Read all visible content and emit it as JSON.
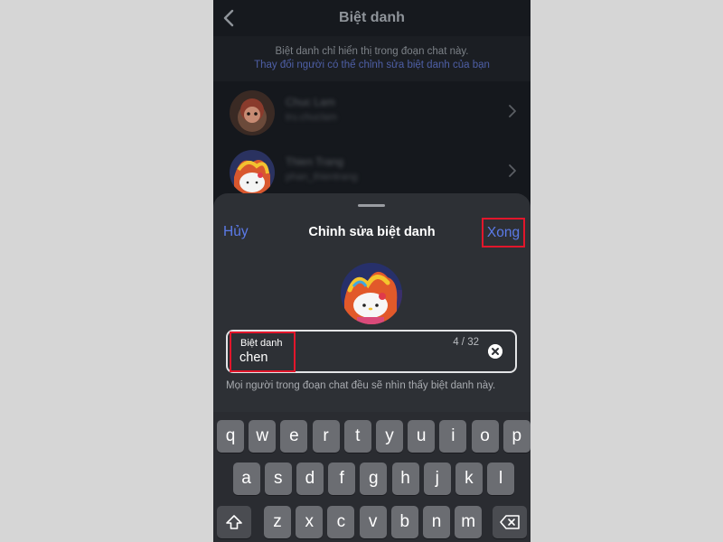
{
  "background_screen": {
    "title": "Biệt danh",
    "info_line1": "Biệt danh chỉ hiển thị trong đoạn chat này.",
    "info_line2": "Thay đổi người có thể chỉnh sửa biệt danh của bạn",
    "members": [
      {
        "name": "Chuc Lam",
        "handle": "tru.chuclam"
      },
      {
        "name": "Thien Trang",
        "handle": "phan_thientrang"
      }
    ]
  },
  "sheet": {
    "cancel_label": "Hủy",
    "title": "Chỉnh sửa biệt danh",
    "done_label": "Xong",
    "field_label": "Biệt danh",
    "field_value": "chen",
    "counter": "4 / 32",
    "helper_text": "Mọi người trong đoạn chat đều sẽ nhìn thấy biệt danh này."
  },
  "keyboard": {
    "row1": [
      "q",
      "w",
      "e",
      "r",
      "t",
      "y",
      "u",
      "i",
      "o",
      "p"
    ],
    "row2": [
      "a",
      "s",
      "d",
      "f",
      "g",
      "h",
      "j",
      "k",
      "l"
    ],
    "row3": [
      "z",
      "x",
      "c",
      "v",
      "b",
      "n",
      "m"
    ],
    "shift_icon": "shift-icon",
    "delete_icon": "backspace-icon"
  },
  "colors": {
    "accent": "#5b7ae8",
    "highlight": "#e2162b",
    "sheet_bg": "#2d3035"
  }
}
